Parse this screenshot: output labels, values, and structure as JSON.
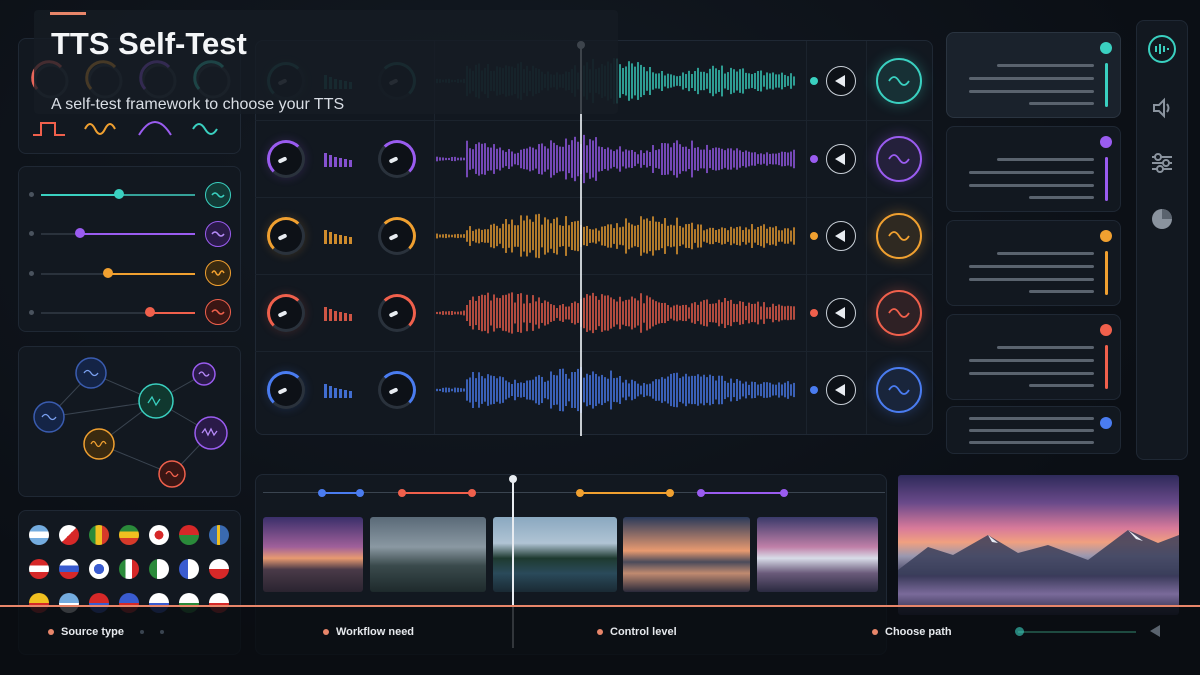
{
  "header": {
    "title": "TTS Self-Test",
    "subtitle": "A self-test framework to choose your TTS"
  },
  "colors": {
    "teal": "#3ad0c0",
    "purple": "#9a5cf0",
    "amber": "#f0a030",
    "red": "#f0604c",
    "blue": "#4a7cf0",
    "accent": "#e8866a"
  },
  "voice_rows": [
    {
      "name": "teal",
      "color": "#3ad0c0"
    },
    {
      "name": "purple",
      "color": "#9a5cf0"
    },
    {
      "name": "amber",
      "color": "#f0a030"
    },
    {
      "name": "red",
      "color": "#f0604c"
    },
    {
      "name": "blue",
      "color": "#4a7cf0"
    }
  ],
  "right_icons": [
    "waveform-icon",
    "audio-source-icon",
    "sliders-icon",
    "pie-chart-icon"
  ],
  "bottom_nav": {
    "steps": [
      {
        "label": "Source type"
      },
      {
        "label": "Workflow need"
      },
      {
        "label": "Control level"
      },
      {
        "label": "Choose path"
      }
    ]
  }
}
